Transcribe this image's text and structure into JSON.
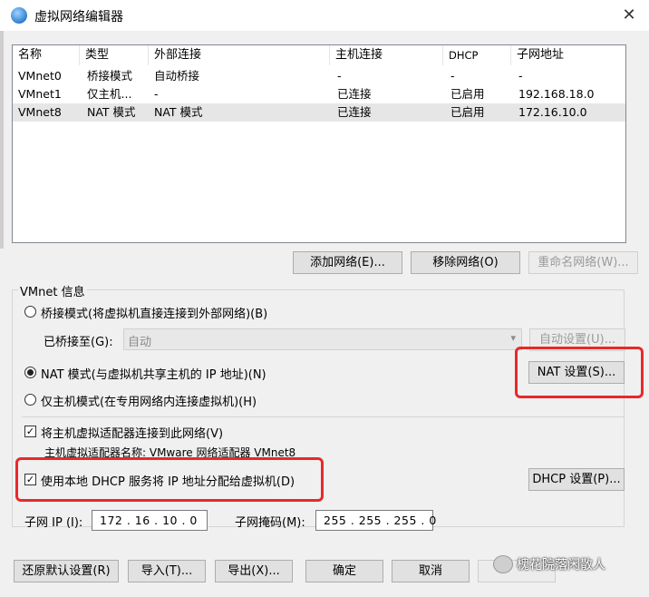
{
  "window": {
    "title": "虚拟网络编辑器",
    "close_glyph": "✕"
  },
  "table": {
    "headers": [
      "名称",
      "类型",
      "外部连接",
      "主机连接",
      "DHCP",
      "子网地址"
    ],
    "rows": [
      [
        "VMnet0",
        "桥接模式",
        "自动桥接",
        "-",
        "-",
        "-"
      ],
      [
        "VMnet1",
        "仅主机...",
        "-",
        "已连接",
        "已启用",
        "192.168.18.0"
      ],
      [
        "VMnet8",
        "NAT 模式",
        "NAT 模式",
        "已连接",
        "已启用",
        "172.16.10.0"
      ]
    ],
    "selected_row": 2
  },
  "list_buttons": {
    "add": "添加网络(E)...",
    "remove": "移除网络(O)",
    "rename": "重命名网络(W)..."
  },
  "vmnet_info": {
    "group_label": "VMnet 信息",
    "bridged_label": "桥接模式(将虚拟机直接连接到外部网络)(B)",
    "bridged_to_label": "已桥接至(G):",
    "bridged_to_value": "自动",
    "auto_settings": "自动设置(U)...",
    "nat_label": "NAT 模式(与虚拟机共享主机的 IP 地址)(N)",
    "nat_settings": "NAT 设置(S)...",
    "hostonly_label": "仅主机模式(在专用网络内连接虚拟机)(H)",
    "selected_mode": "nat",
    "connect_adapter_label": "将主机虚拟适配器连接到此网络(V)",
    "connect_adapter_checked": true,
    "adapter_name": "主机虚拟适配器名称: VMware 网络适配器 VMnet8",
    "dhcp_label": "使用本地 DHCP 服务将 IP 地址分配给虚拟机(D)",
    "dhcp_checked": true,
    "dhcp_settings": "DHCP 设置(P)...",
    "subnet_ip_label": "子网 IP (I):",
    "subnet_ip_value": "172 . 16 . 10 . 0",
    "subnet_mask_label": "子网掩码(M):",
    "subnet_mask_value": "255 . 255 . 255 . 0"
  },
  "footer": {
    "restore": "还原默认设置(R)",
    "import": "导入(T)...",
    "export": "导出(X)...",
    "ok": "确定",
    "cancel": "取消"
  },
  "watermark": "槐花院落闲散人",
  "colors": {
    "highlight": "#e8292a",
    "selected_row": "#e6e6e6"
  }
}
